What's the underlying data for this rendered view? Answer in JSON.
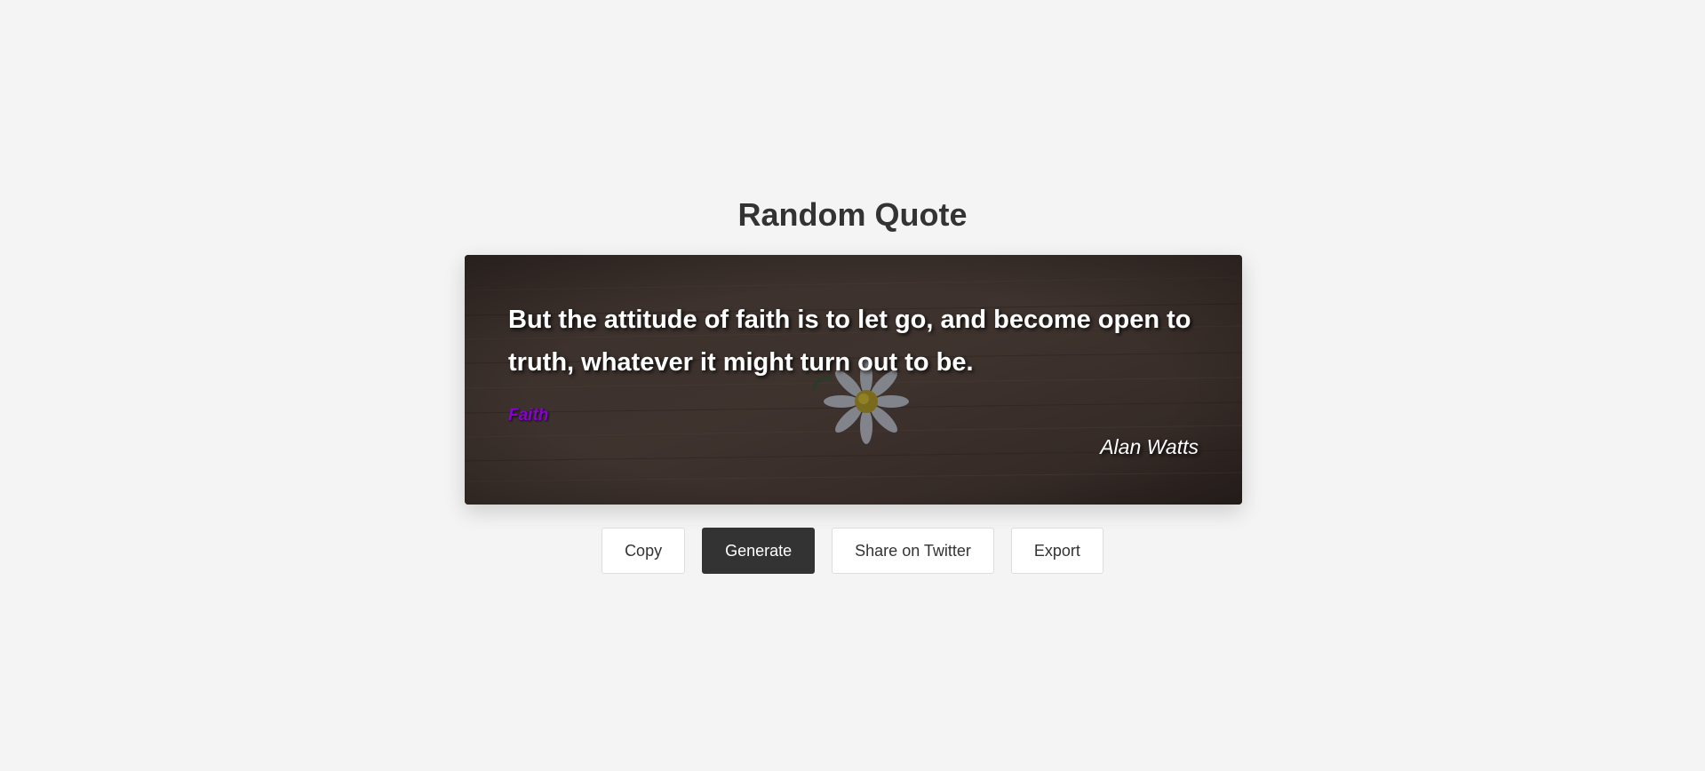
{
  "page": {
    "title": "Random Quote"
  },
  "quote": {
    "text": "But the attitude of faith is to let go, and become open to truth, whatever it might turn out to be.",
    "tag": "Faith",
    "author": "Alan Watts",
    "background_image": "daisy-on-wooden-floor"
  },
  "actions": {
    "copy_label": "Copy",
    "generate_label": "Generate",
    "share_label": "Share on Twitter",
    "export_label": "Export"
  },
  "colors": {
    "page_background": "#f4f4f4",
    "title_text": "#333333",
    "tag_accent": "#8a00d4",
    "primary_button": "#333333"
  }
}
